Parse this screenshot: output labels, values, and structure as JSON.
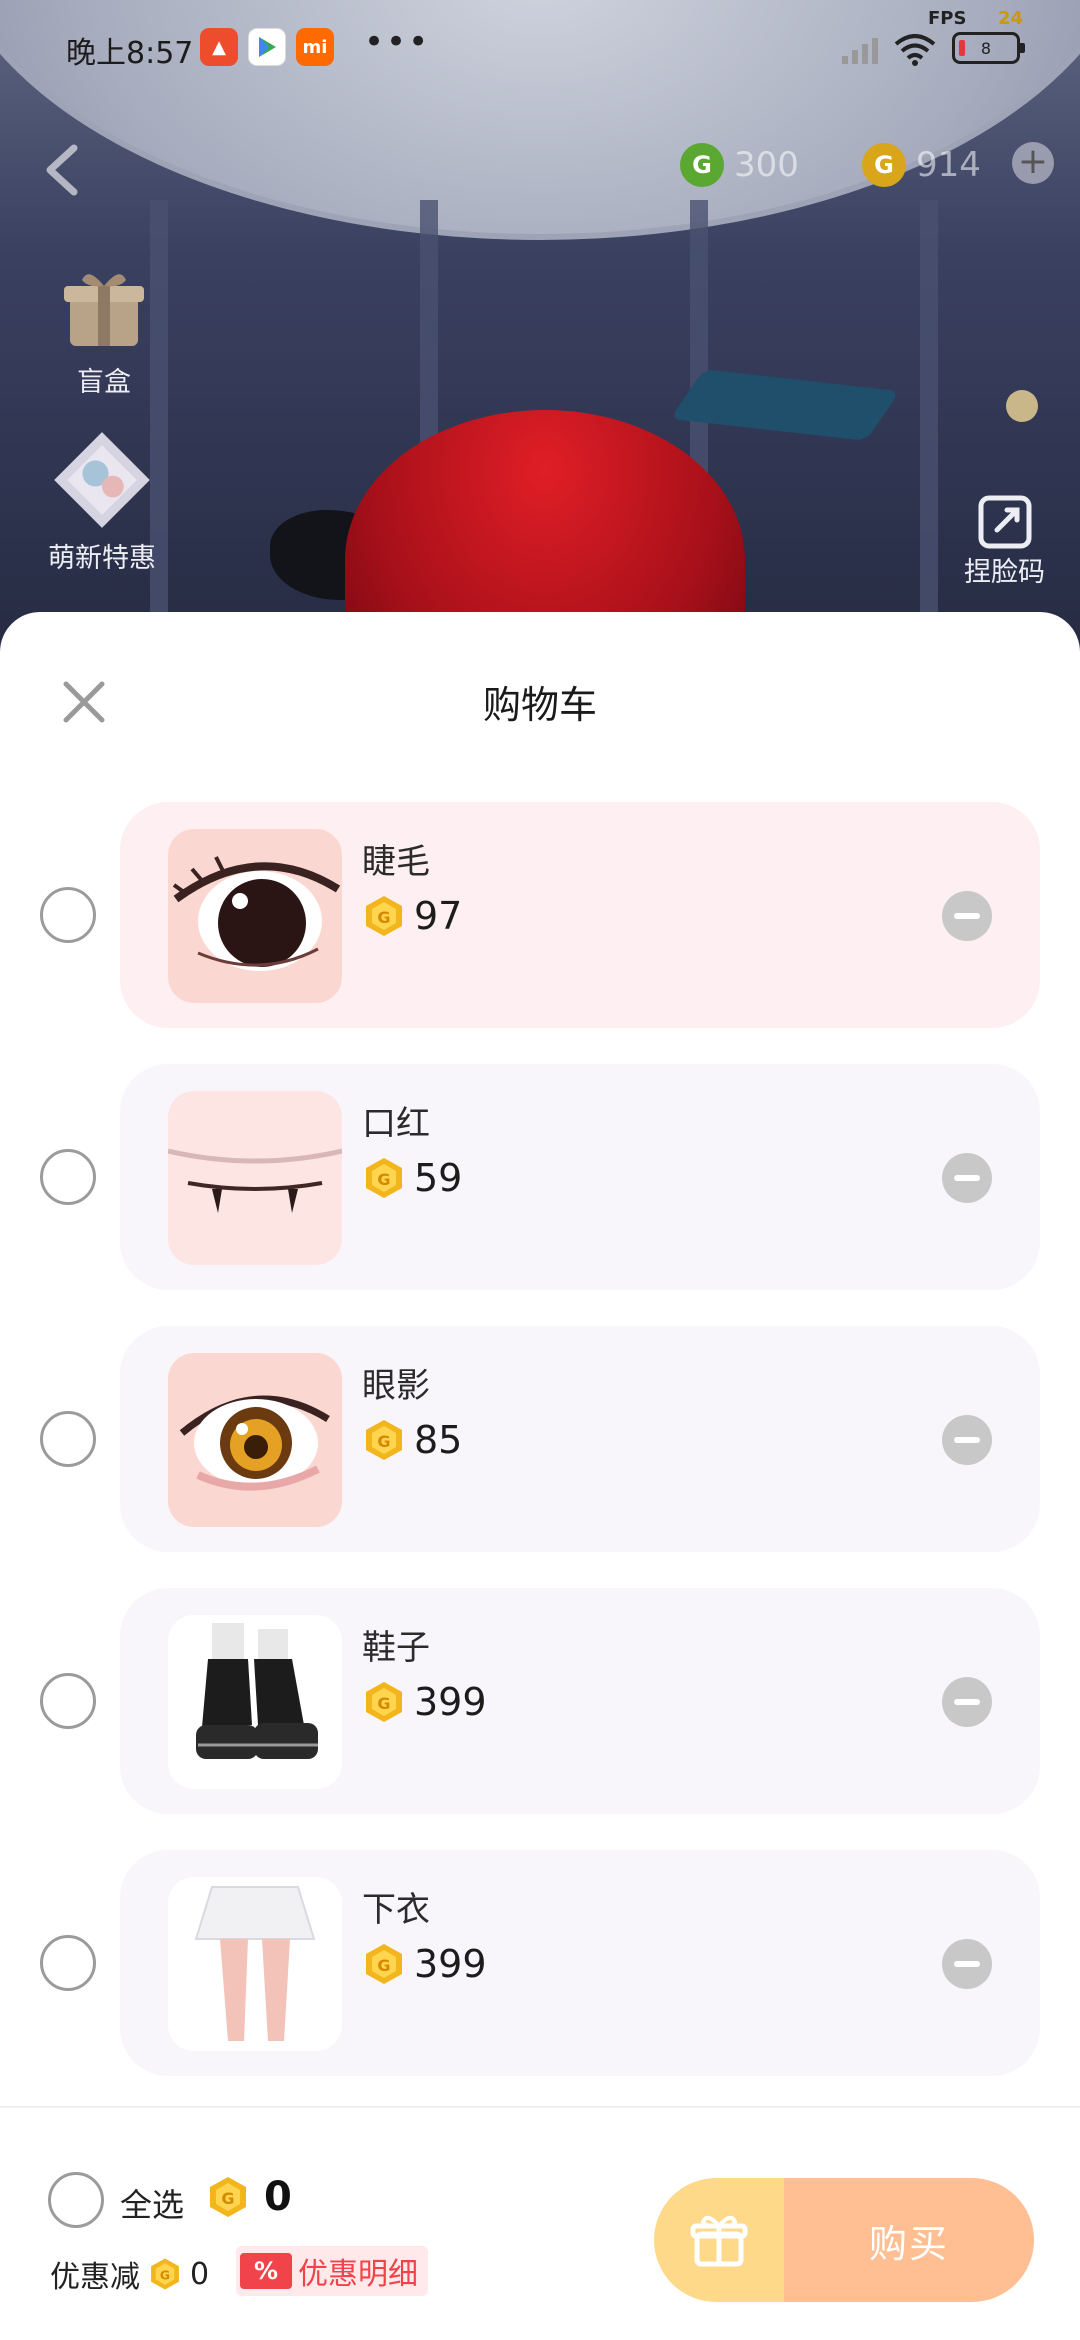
{
  "status_bar": {
    "time": "晚上8:57",
    "fps_label": "FPS",
    "fps_value": "24",
    "battery": "8"
  },
  "header": {
    "currency_green": "300",
    "currency_gold": "914",
    "plus": "+"
  },
  "side_menu": {
    "blind_box": "盲盒",
    "newbie_deal": "萌新特惠",
    "face_code": "捏脸码"
  },
  "cart": {
    "title": "购物车",
    "items": [
      {
        "name": "睫毛",
        "price": "97"
      },
      {
        "name": "口红",
        "price": "59"
      },
      {
        "name": "眼影",
        "price": "85"
      },
      {
        "name": "鞋子",
        "price": "399"
      },
      {
        "name": "下衣",
        "price": "399"
      }
    ]
  },
  "footer": {
    "select_all": "全选",
    "total": "0",
    "discount_label": "优惠减",
    "discount_value": "0",
    "detail_badge": "%",
    "detail_label": "优惠明细",
    "buy_label": "购买"
  },
  "colors": {
    "coin_gold": "#f3b51c",
    "buy_button": "#ffbf92",
    "gift_button": "#ffd98a",
    "detail_red": "#f0434a"
  }
}
